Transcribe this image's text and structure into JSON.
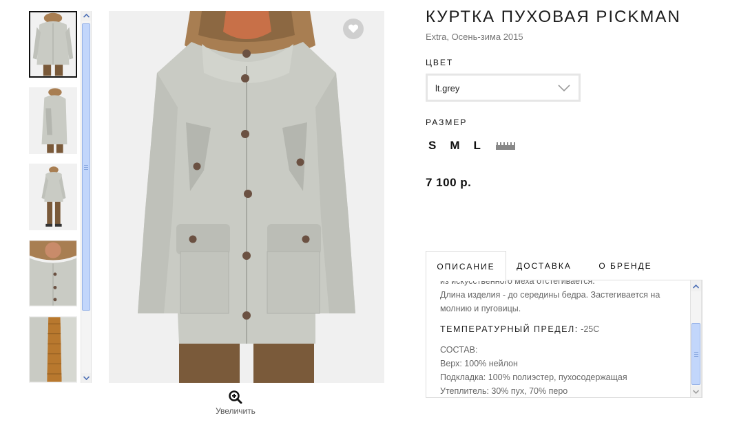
{
  "product": {
    "title": "КУРТКА ПУХОВАЯ PICKMAN",
    "subtitle": "Extra, Осень-зима 2015",
    "color_label": "ЦВЕТ",
    "color_value": "lt.grey",
    "size_label": "РАЗМЕР",
    "sizes": [
      "S",
      "M",
      "L"
    ],
    "price": "7 100 р."
  },
  "gallery": {
    "zoom_label": "Увеличить",
    "thumbnails": [
      "front-view",
      "side-view",
      "full-body-view",
      "hood-detail",
      "lining-detail"
    ],
    "colors": {
      "jacket": "#c9cbc4",
      "jacket_shade": "#b4b6af",
      "fur": "#a87e52",
      "pants": "#7a5a3a"
    }
  },
  "tabs": {
    "items": [
      "ОПИСАНИЕ",
      "ДОСТАВКА",
      "О БРЕНДЕ"
    ],
    "active": "ОПИСАНИЕ"
  },
  "description": {
    "line_cut": "из искусственного меха отстегивается.",
    "length_1": "Длина изделия - до середины бедра. Застегивается на",
    "length_2": "молнию и пуговицы.",
    "temp_label": "ТЕМПЕРАТУРНЫЙ ПРЕДЕЛ:",
    "temp_value": "-25С",
    "composition_label": "СОСТАВ:",
    "composition_1": "Верх: 100% нейлон",
    "composition_2": "Подкладка: 100% полиэстер, пухосодержащая",
    "composition_3": "Утеплитель: 30% пух, 70% перо"
  },
  "icons": {
    "favorite": "heart-icon",
    "zoom": "zoom-in-icon",
    "select": "chevron-down-icon",
    "size_guide": "ruler-icon",
    "scroll_up": "arrow-up-icon",
    "scroll_down": "arrow-down-icon"
  }
}
